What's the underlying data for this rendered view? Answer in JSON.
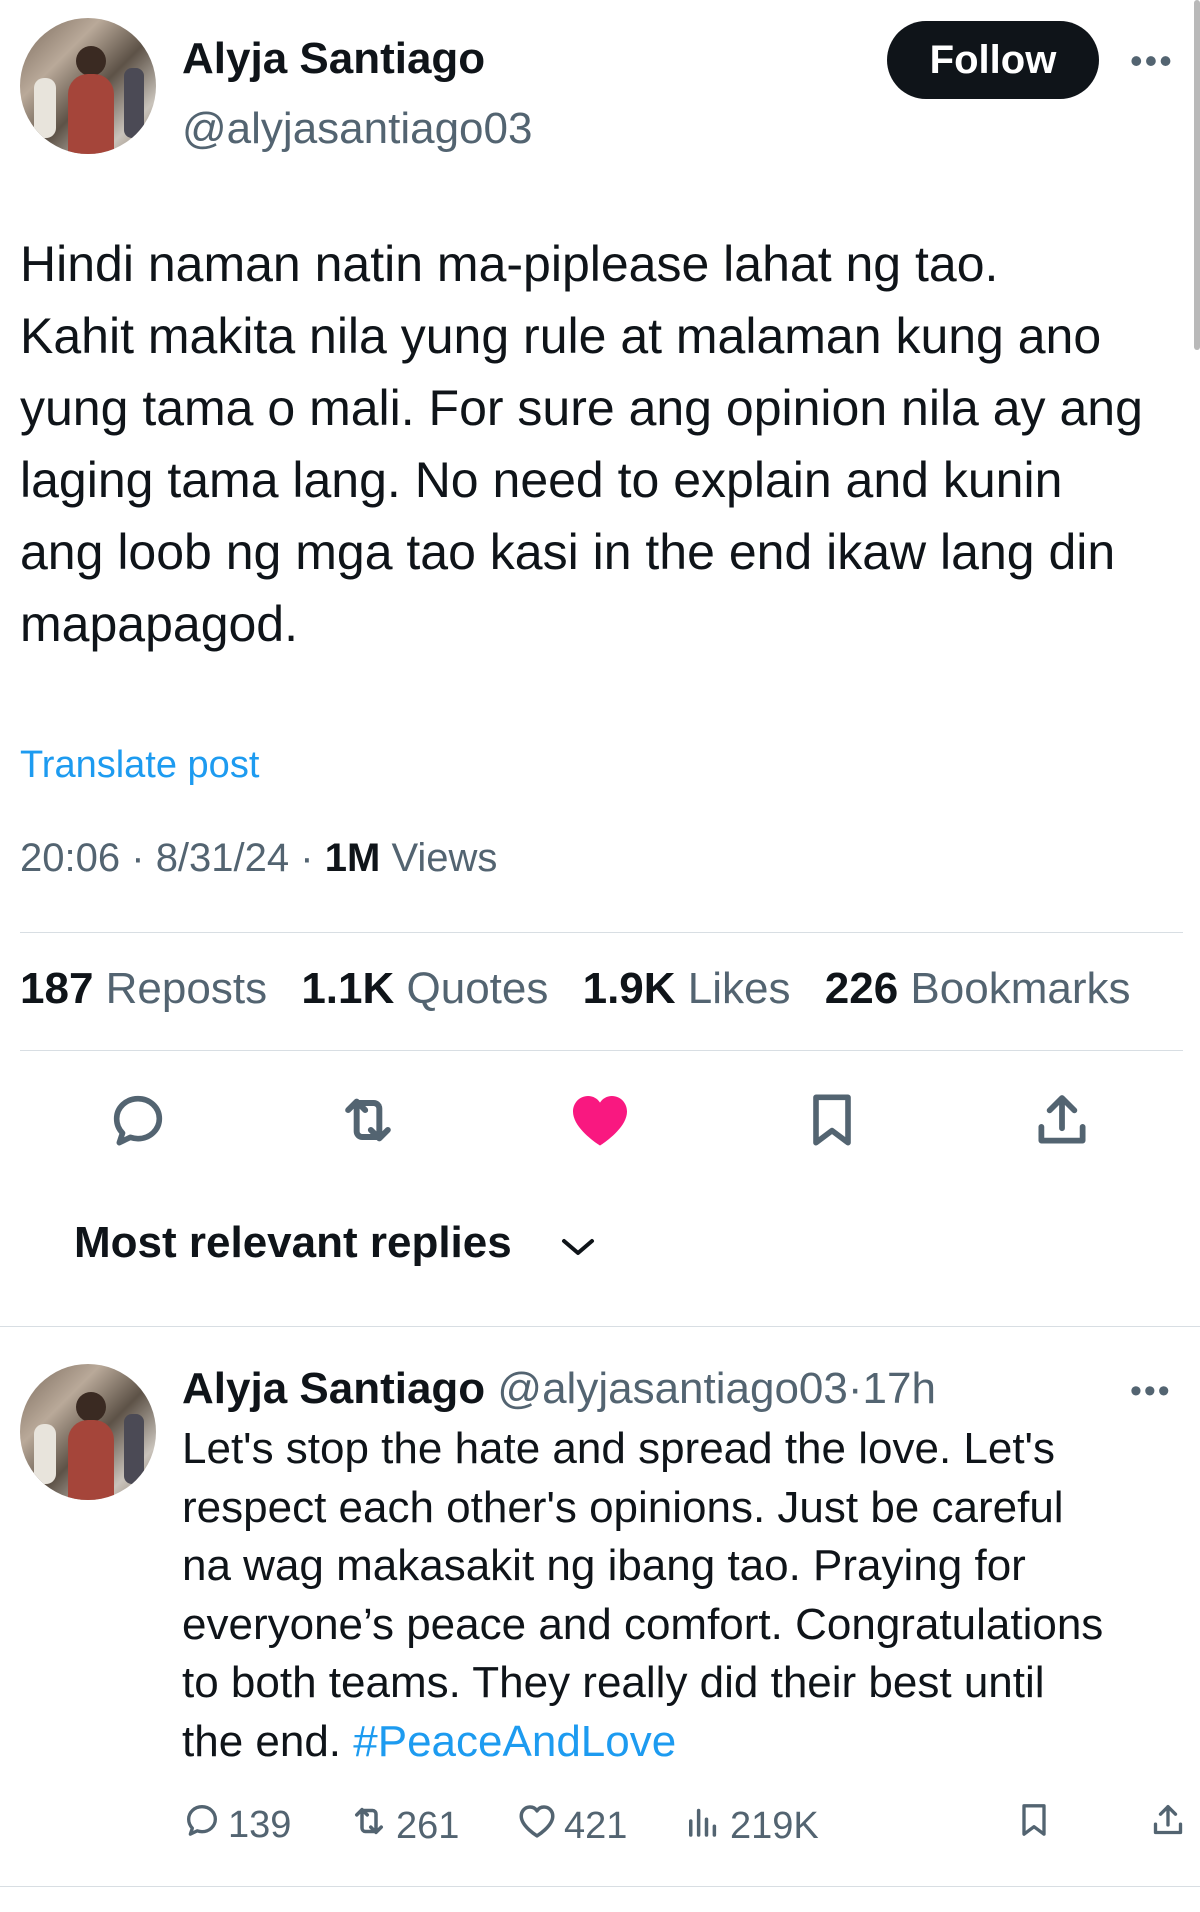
{
  "post": {
    "author_name": "Alyja Santiago",
    "author_handle": "@alyjasantiago03",
    "follow_label": "Follow",
    "more_label": "•••",
    "text": "Hindi naman natin ma-piplease lahat ng tao.\nKahit makita nila yung rule at malaman kung ano\nyung tama o mali. For sure ang opinion nila ay ang\nlaging tama lang. No need to explain and kunin\nang loob ng mga tao kasi in the end ikaw lang din\nmapapagod.",
    "translate_label": "Translate post",
    "time": "20:06",
    "date": "8/31/24",
    "views_count": "1M",
    "views_label": "Views",
    "separator": "·"
  },
  "stats": {
    "reposts_count": "187",
    "reposts_label": "Reposts",
    "quotes_count": "1.1K",
    "quotes_label": "Quotes",
    "likes_count": "1.9K",
    "likes_label": "Likes",
    "bookmarks_count": "226",
    "bookmarks_label": "Bookmarks"
  },
  "actions": {
    "icons": [
      "reply-icon",
      "repost-icon",
      "like-icon-filled",
      "bookmark-icon",
      "share-icon"
    ],
    "like_color": "#f91880",
    "icon_color": "#536471"
  },
  "replies_sort": {
    "label": "Most relevant replies"
  },
  "reply": {
    "author_name": "Alyja Santiago",
    "author_handle": "@alyjasantiago03",
    "separator": "·",
    "time_ago": "17h",
    "more_label": "•••",
    "text": "Let's stop the hate and spread the love. Let's\nrespect each other's opinions. Just be careful\nna wag makasakit ng ibang tao. Praying for\neveryone’s peace and comfort. Congratulations\nto both teams. They really did their best until\nthe end. ",
    "hashtag": "#PeaceAndLove",
    "replies_count": "139",
    "reposts_count": "261",
    "likes_count": "421",
    "views_count": "219K"
  },
  "colors": {
    "accent": "#1d9bf0",
    "text": "#0f1419",
    "muted": "#536471",
    "divider": "#d8dee3"
  }
}
